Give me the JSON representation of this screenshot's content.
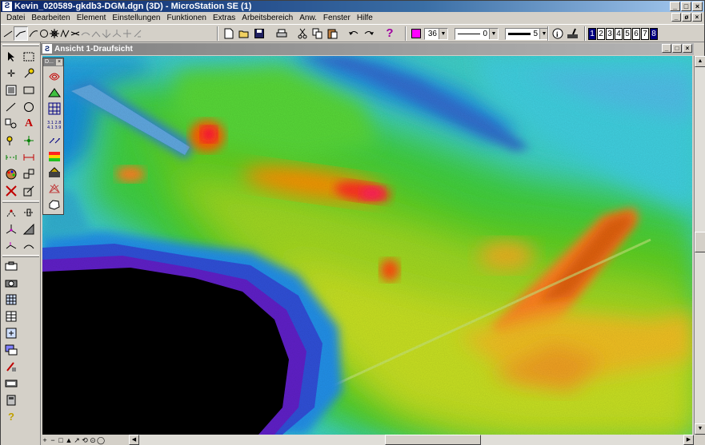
{
  "window": {
    "title": "Kevin_020589-gkdb3-DGM.dgn (3D) - MicroStation SE (1)",
    "app_icon": "microstation-logo-icon",
    "controls": [
      "_",
      "□",
      "×"
    ]
  },
  "menu": {
    "items": [
      "Datei",
      "Bearbeiten",
      "Element",
      "Einstellungen",
      "Funktionen",
      "Extras",
      "Arbeitsbereich",
      "Anw.",
      "Fenster",
      "Hilfe"
    ],
    "controls": [
      "_",
      "ø",
      "×"
    ]
  },
  "toolbar": {
    "attributes": {
      "active_color": "#ff00ff",
      "color_value": "36",
      "line_style_value": "0",
      "line_weight_value": "5"
    },
    "views": [
      "1",
      "2",
      "3",
      "4",
      "5",
      "6",
      "7",
      "8"
    ],
    "active_views": [
      "1",
      "8"
    ]
  },
  "view": {
    "title": "Ansicht 1-Draufsicht",
    "controls": [
      "_",
      "□",
      "×"
    ]
  },
  "floating_palette": {
    "title": "D..."
  },
  "view_controls": [
    "+",
    "−",
    "□",
    "▲",
    "↗",
    "⟲",
    "⊙",
    "◯"
  ],
  "colors": {
    "titlebar_active": "#0a246a",
    "titlebar_inactive": "#808080",
    "face": "#d4d0c8"
  }
}
